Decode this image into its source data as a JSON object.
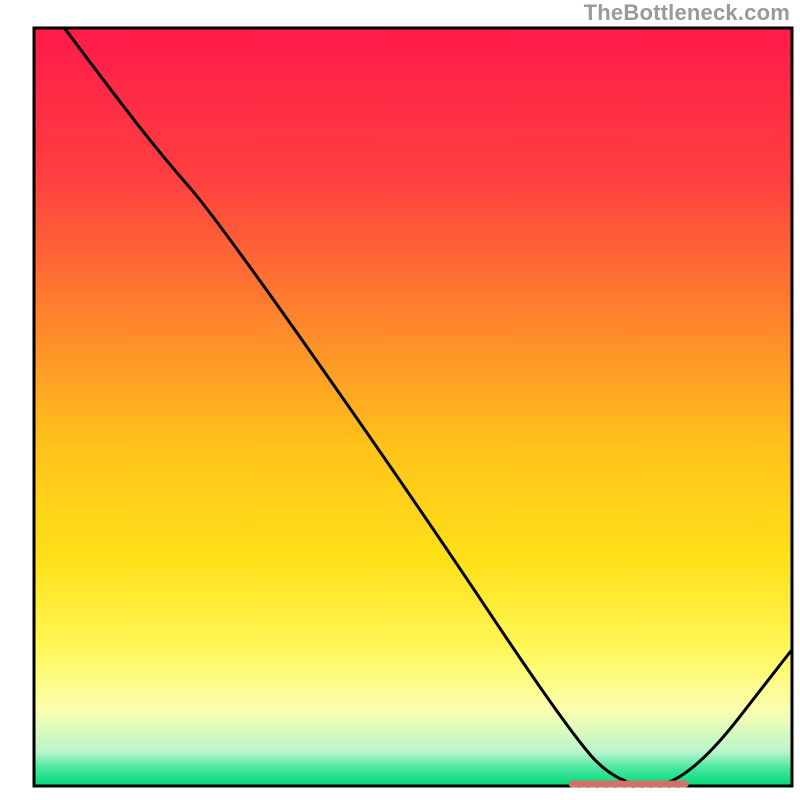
{
  "watermark": "TheBottleneck.com",
  "colors": {
    "gradient_stops": [
      {
        "offset": 0.0,
        "color": "#ff1a4a"
      },
      {
        "offset": 0.2,
        "color": "#ff4040"
      },
      {
        "offset": 0.4,
        "color": "#ff8a2a"
      },
      {
        "offset": 0.55,
        "color": "#ffc21a"
      },
      {
        "offset": 0.7,
        "color": "#ffe018"
      },
      {
        "offset": 0.82,
        "color": "#fff85a"
      },
      {
        "offset": 0.9,
        "color": "#fbffb0"
      },
      {
        "offset": 0.955,
        "color": "#b9f5cc"
      },
      {
        "offset": 0.975,
        "color": "#4de8a0"
      },
      {
        "offset": 1.0,
        "color": "#00d878"
      }
    ],
    "border": "#000000",
    "curve": "#000000",
    "marker": "#d47068"
  },
  "chart_data": {
    "type": "line",
    "title": "",
    "xlabel": "",
    "ylabel": "",
    "xlim": [
      0,
      100
    ],
    "ylim": [
      0,
      100
    ],
    "grid": false,
    "legend": null,
    "series": [
      {
        "name": "bottleneck-curve",
        "x": [
          4,
          10,
          17,
          24,
          50,
          70,
          77,
          86,
          100
        ],
        "y": [
          100,
          92,
          83,
          75,
          38,
          8,
          0,
          0,
          18
        ]
      }
    ],
    "flat_marker": {
      "x_start": 71,
      "x_end": 86,
      "y": 0
    }
  }
}
